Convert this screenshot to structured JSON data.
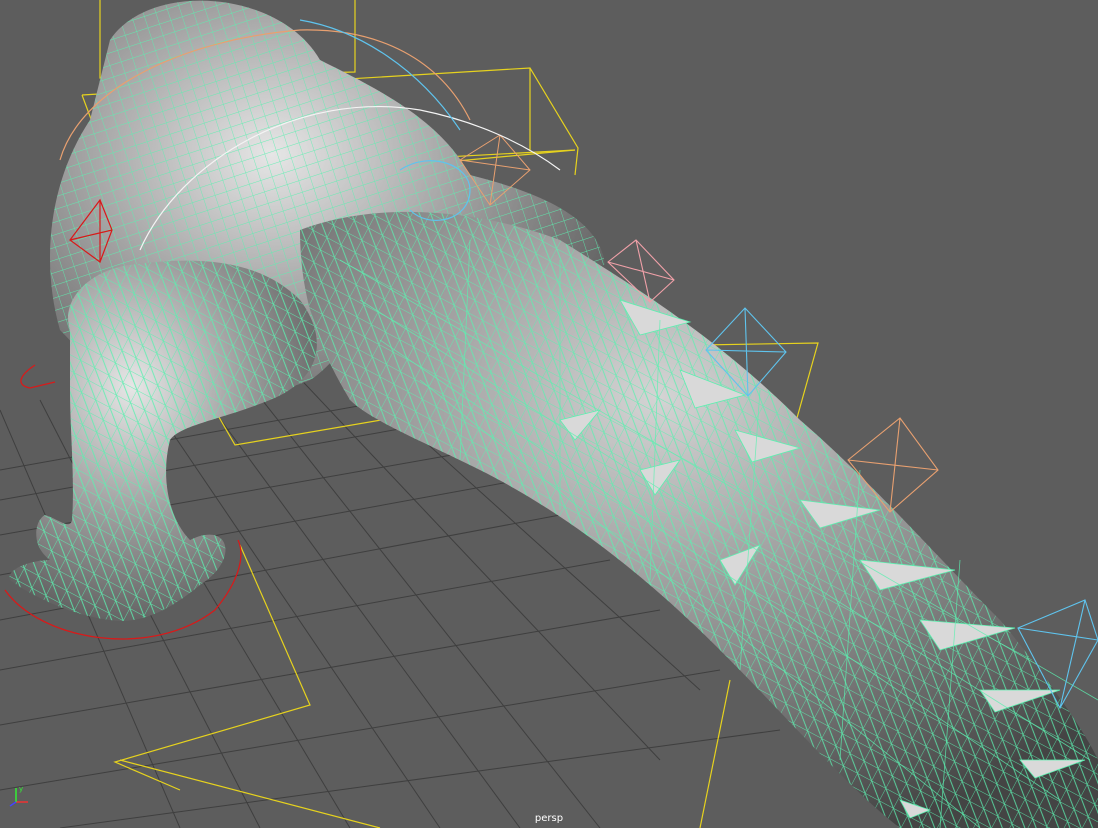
{
  "viewport": {
    "camera_label": "persp",
    "axis_labels": {
      "x": "x",
      "y": "y",
      "z": "z"
    },
    "colors": {
      "background": "#5d5d5d",
      "grid": "#3f3f3f",
      "wireframe": "#5cf0b0",
      "mesh": "#9c9c9c",
      "bounding_box": "#e6d21e",
      "joint_blue": "#5fc4ee",
      "joint_orange": "#e8a070",
      "joint_pink": "#f0a0a8",
      "control_red": "#d81a1a"
    }
  }
}
